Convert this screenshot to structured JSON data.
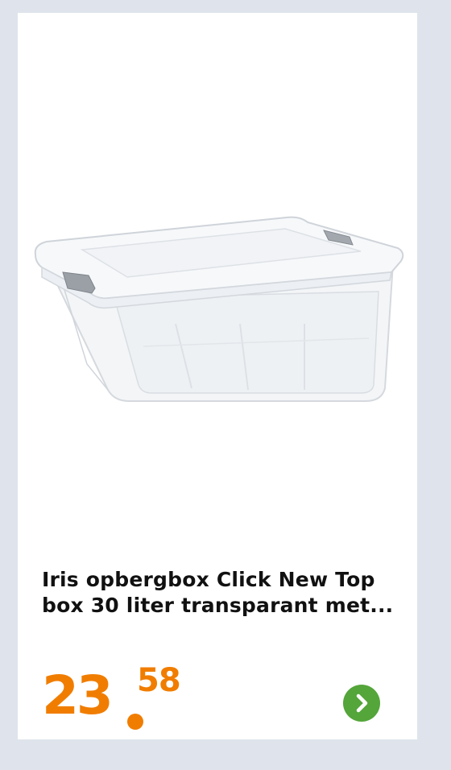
{
  "product": {
    "title": "Iris opbergbox Click New Top box 30 liter transparant met...",
    "image": "transparent-storage-box-with-lid",
    "price_integer": "23",
    "price_decimal": "58",
    "next_icon": "chevron-right-icon"
  },
  "colors": {
    "page_background": "#dfe4ec",
    "card_background": "#ffffff",
    "price": "#f07d00",
    "next_button": "#54a53a",
    "title_text": "#111111"
  }
}
